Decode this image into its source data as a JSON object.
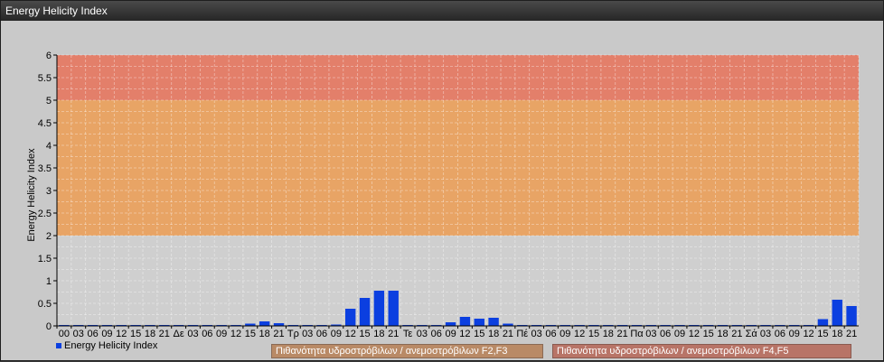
{
  "window": {
    "title": "Energy Helicity Index"
  },
  "chart_data": {
    "type": "bar",
    "ylabel": "Energy Helicity Index",
    "xlabel": "",
    "ylim": [
      0,
      6
    ],
    "yticks": [
      "0",
      "0.5",
      "1",
      "1.5",
      "2",
      "2.5",
      "3",
      "3.5",
      "4",
      "4.5",
      "5",
      "5.5",
      "6"
    ],
    "categories": [
      "00",
      "03",
      "06",
      "09",
      "12",
      "15",
      "18",
      "21",
      "Δε",
      "03",
      "06",
      "09",
      "12",
      "15",
      "18",
      "21",
      "Τρ",
      "03",
      "06",
      "09",
      "12",
      "15",
      "18",
      "21",
      "Τε",
      "03",
      "06",
      "09",
      "12",
      "15",
      "18",
      "21",
      "Πέ",
      "03",
      "06",
      "09",
      "12",
      "15",
      "18",
      "21",
      "Πα",
      "03",
      "06",
      "09",
      "12",
      "15",
      "18",
      "21",
      "Σά",
      "03",
      "06",
      "09",
      "12",
      "15",
      "18",
      "21"
    ],
    "series": [
      {
        "name": "Energy Helicity Index",
        "color": "#0b3fe0",
        "values": [
          0.02,
          0.02,
          0.02,
          0.02,
          0.02,
          0.02,
          0.02,
          0.02,
          0.02,
          0.02,
          0.02,
          0.02,
          0.02,
          0.05,
          0.1,
          0.06,
          0.02,
          0.02,
          0.02,
          0.03,
          0.38,
          0.62,
          0.78,
          0.78,
          0.02,
          0.02,
          0.02,
          0.08,
          0.2,
          0.16,
          0.18,
          0.05,
          0.02,
          0.02,
          0.02,
          0.02,
          0.02,
          0.02,
          0.02,
          0.02,
          0.02,
          0.02,
          0.02,
          0.02,
          0.02,
          0.02,
          0.02,
          0.02,
          0.02,
          0.02,
          0.02,
          0.02,
          0.02,
          0.15,
          0.58,
          0.44
        ]
      }
    ],
    "bands": [
      {
        "from": 2,
        "to": 5,
        "color": "#e8a465"
      },
      {
        "from": 5,
        "to": 6,
        "color": "#e37f6a"
      }
    ],
    "grid": true,
    "legend": {
      "series_label": "Energy Helicity Index",
      "band_labels": [
        "Πιθανότητα υδροστρόβιλων / ανεμοστρόβιλων F2,F3",
        "Πιθανότητα υδροστρόβιλων / ανεμοστρόβιλων F4,F5"
      ],
      "band_colors": [
        "#b98a66",
        "#b87467"
      ]
    }
  }
}
